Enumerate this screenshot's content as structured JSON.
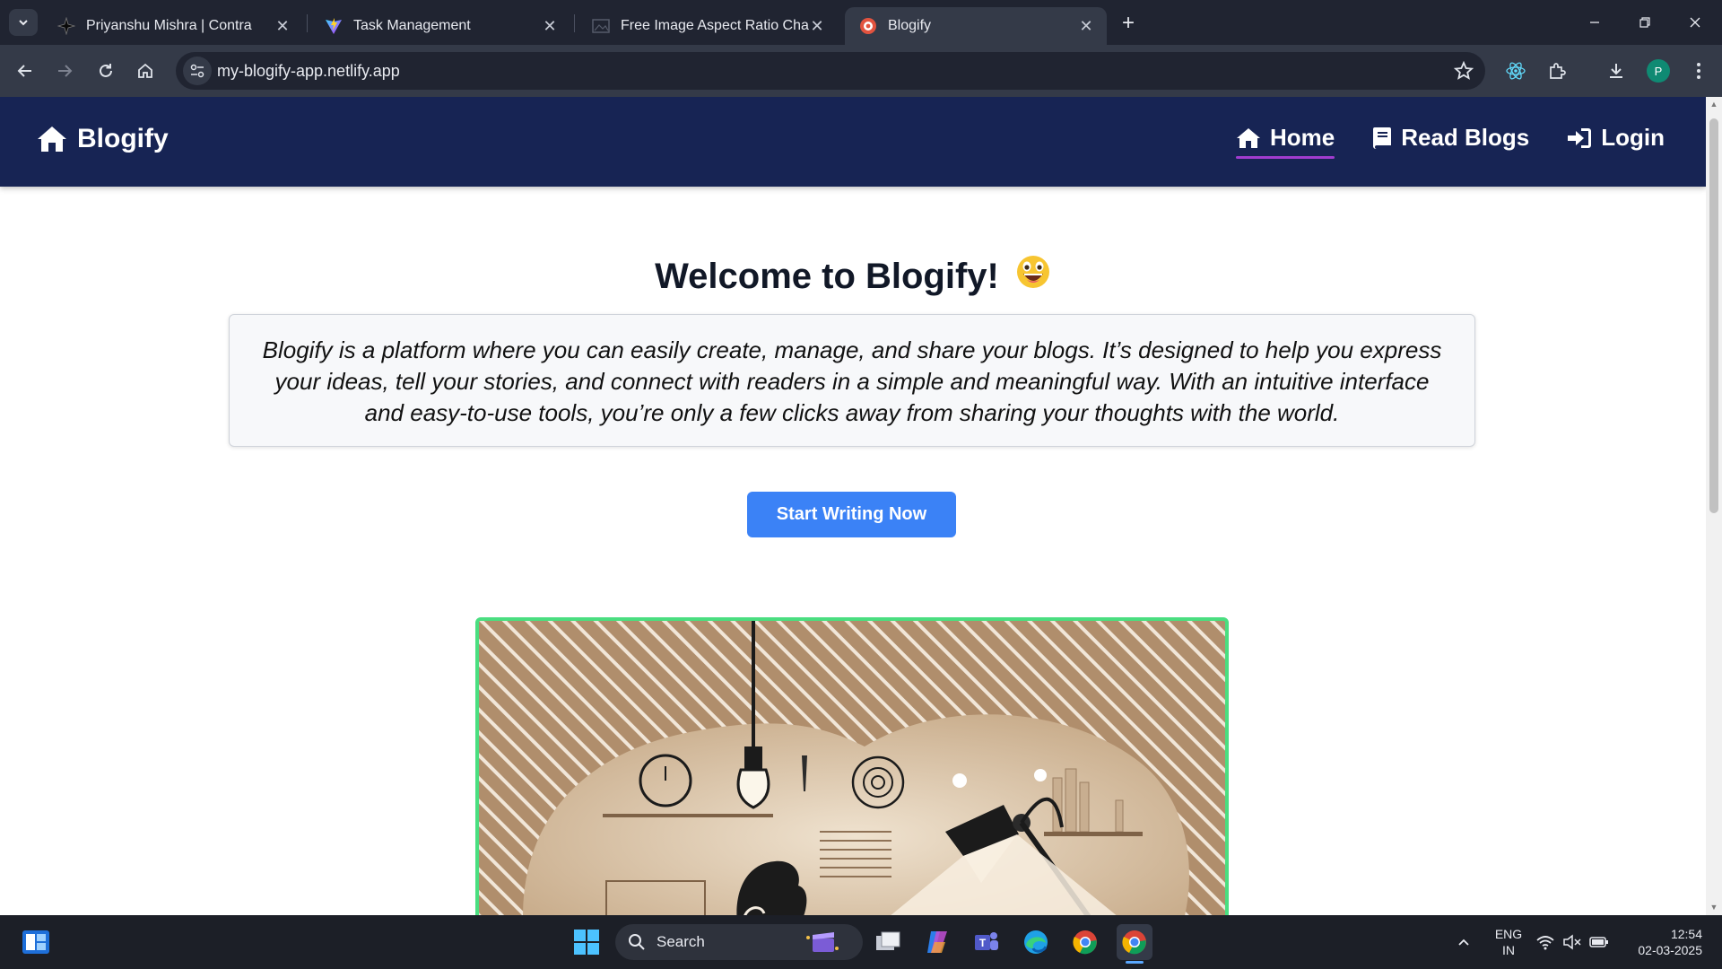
{
  "browser": {
    "tabs": [
      {
        "title": "Priyanshu Mishra | Contra",
        "active": false
      },
      {
        "title": "Task Management",
        "active": false
      },
      {
        "title": "Free Image Aspect Ratio Changer",
        "active": false
      },
      {
        "title": "Blogify",
        "active": true
      }
    ],
    "url": "my-blogify-app.netlify.app",
    "profile_initial": "P"
  },
  "site": {
    "brand": "Blogify",
    "nav": [
      {
        "label": "Home",
        "icon": "home-icon",
        "active": true
      },
      {
        "label": "Read Blogs",
        "icon": "book-icon",
        "active": false
      },
      {
        "label": "Login",
        "icon": "sign-in-icon",
        "active": false
      }
    ],
    "hero": {
      "title": "Welcome to Blogify!",
      "emoji": "grinning-face-emoji",
      "intro": "Blogify is a platform where you can easily create, manage, and share your blogs. It’s designed to help you express your ideas, tell your stories, and connect with readers in a simple and meaningful way. With an intuitive interface and easy-to-use tools, you’re only a few clicks away from sharing your thoughts with the world.",
      "cta": "Start Writing Now"
    },
    "colors": {
      "navbar": "#172454",
      "cta": "#3b82f6",
      "image_border": "#4ade80",
      "active_underline": "#a13ccf"
    }
  },
  "taskbar": {
    "search_label": "Search",
    "language": "ENG",
    "region": "IN",
    "time": "12:54",
    "date": "02-03-2025"
  }
}
